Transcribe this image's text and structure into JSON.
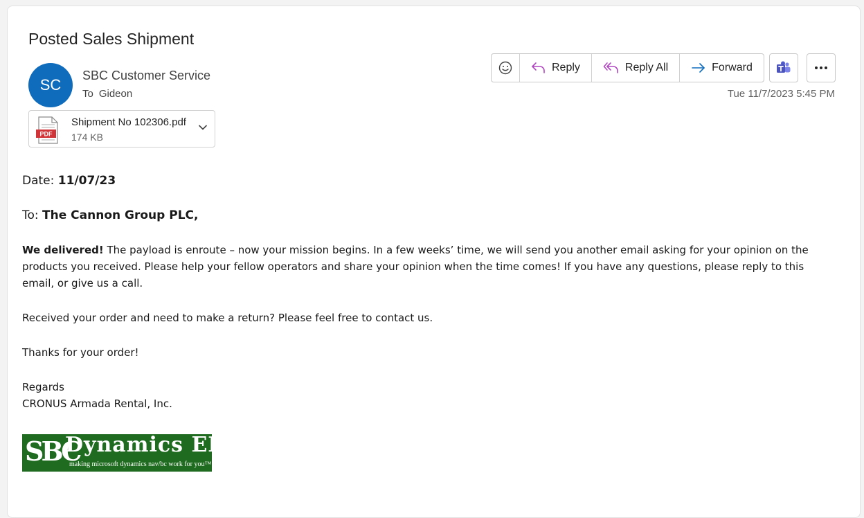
{
  "email": {
    "subject": "Posted Sales Shipment",
    "avatar_initials": "SC",
    "sender_name": "SBC Customer Service",
    "to_label": "To",
    "recipient": "Gideon",
    "timestamp": "Tue 11/7/2023 5:45 PM"
  },
  "attachment": {
    "name": "Shipment No 102306.pdf",
    "size": "174 KB",
    "type_label": "PDF",
    "icon": "pdf-file-icon"
  },
  "toolbar": {
    "reply_label": "Reply",
    "reply_all_label": "Reply All",
    "forward_label": "Forward",
    "icons": [
      "emoji-icon",
      "reply-icon",
      "reply-all-icon",
      "forward-icon",
      "teams-icon",
      "more-icon"
    ]
  },
  "body": {
    "date_label": "Date: ",
    "date_value": "11/07/23",
    "to_label": "To: ",
    "to_value": "The Cannon Group PLC,",
    "para1_bold": "We delivered!",
    "para1_text": " The payload is enroute – now your mission begins. In a few weeks’ time, we will send you another email asking for your opinion on the products you received. Please help your fellow operators and share your opinion when the time comes! If you have any questions, please reply to this email, or give us a call.",
    "para2": "Received your order and need to make a return? Please feel free to contact us.",
    "para3": "Thanks for your order!",
    "regards": "Regards",
    "company": "CRONUS Armada Rental, Inc."
  },
  "logo": {
    "sbc": "SBC",
    "title": "Dynamics ERP",
    "tagline": "making microsoft dynamics nav/bc work for you™"
  },
  "colors": {
    "avatar_bg": "#0f6cbd",
    "reply_icon": "#b146c2",
    "forward_icon": "#0f6cbd",
    "teams": "#4b53bc",
    "pdf_red": "#d13438",
    "logo_green": "#1f6b1f"
  }
}
